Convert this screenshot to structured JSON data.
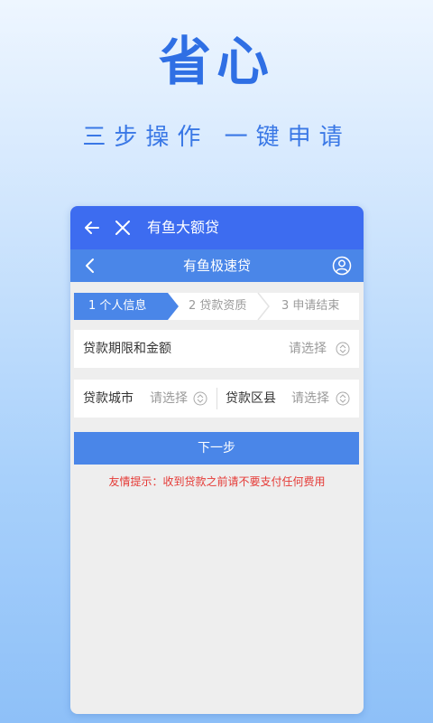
{
  "hero": {
    "title": "省心",
    "subtitle": "三步操作  一键申请"
  },
  "appbar": {
    "title": "有鱼大额贷"
  },
  "navbar": {
    "title": "有鱼极速贷"
  },
  "steps": [
    {
      "label": "1 个人信息",
      "active": true
    },
    {
      "label": "2 贷款资质",
      "active": false
    },
    {
      "label": "3 申请结束",
      "active": false
    }
  ],
  "form": {
    "term_amount": {
      "label": "贷款期限和金额",
      "value": "请选择"
    },
    "city": {
      "label": "贷款城市",
      "value": "请选择"
    },
    "district": {
      "label": "贷款区县",
      "value": "请选择"
    }
  },
  "next_button": "下一步",
  "tip": "友情提示：收到贷款之前请不要支付任何费用",
  "colors": {
    "primary": "#3d6cf0",
    "accent": "#4a86e8",
    "warning": "#e53935",
    "hero_text": "#2f6fe4"
  }
}
